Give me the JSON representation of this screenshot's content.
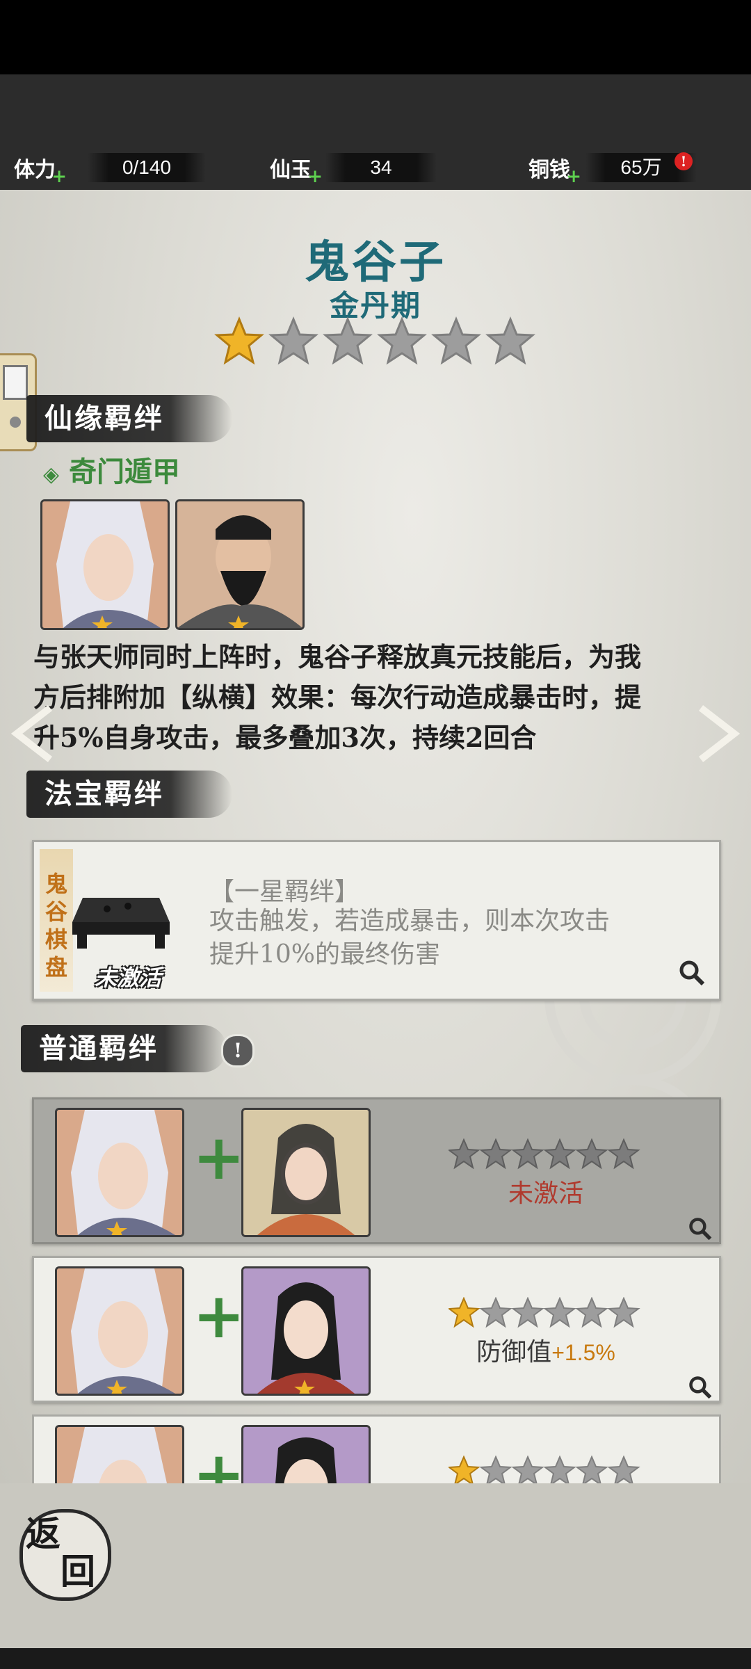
{
  "resources": [
    {
      "label": "体力",
      "value": "0/140"
    },
    {
      "label": "仙玉",
      "value": "34"
    },
    {
      "label": "铜钱",
      "value": "65万"
    }
  ],
  "hero": {
    "name": "鬼谷子",
    "rank": "金丹期",
    "stars_filled": 1,
    "stars_total": 6
  },
  "xianyuan": {
    "title": "仙缘羁绊",
    "subtitle": "奇门遁甲",
    "description_lines": [
      "与张天师同时上阵时，鬼谷子释放真元技能后，为我",
      "方后排附加【纵横】效果：每次行动造成暴击时，提",
      "升5%自身攻击，最多叠加3次，持续2回合"
    ]
  },
  "fabao": {
    "title": "法宝羁绊",
    "item_name": "鬼谷棋盘",
    "item_status": "未激活",
    "bond_title": "【一星羁绊】",
    "bond_desc_lines": [
      "攻击触发，若造成暴击，则本次攻击",
      "提升10%的最终伤害"
    ]
  },
  "putong": {
    "title": "普通羁绊",
    "rows": [
      {
        "stars_filled": 0,
        "stars_total": 6,
        "status": "未激活",
        "active": false
      },
      {
        "stars_filled": 1,
        "stars_total": 6,
        "bonus_label": "防御值",
        "bonus_value": "+1.5%",
        "active": true
      },
      {
        "stars_filled": 1,
        "stars_total": 6,
        "active": true
      }
    ]
  },
  "back_button": "返回",
  "colors": {
    "accent": "#1f6a78",
    "gold": "#f0b428",
    "green": "#3e8a3e",
    "inactive_red": "#b03a2e",
    "bonus": "#c87a10"
  }
}
